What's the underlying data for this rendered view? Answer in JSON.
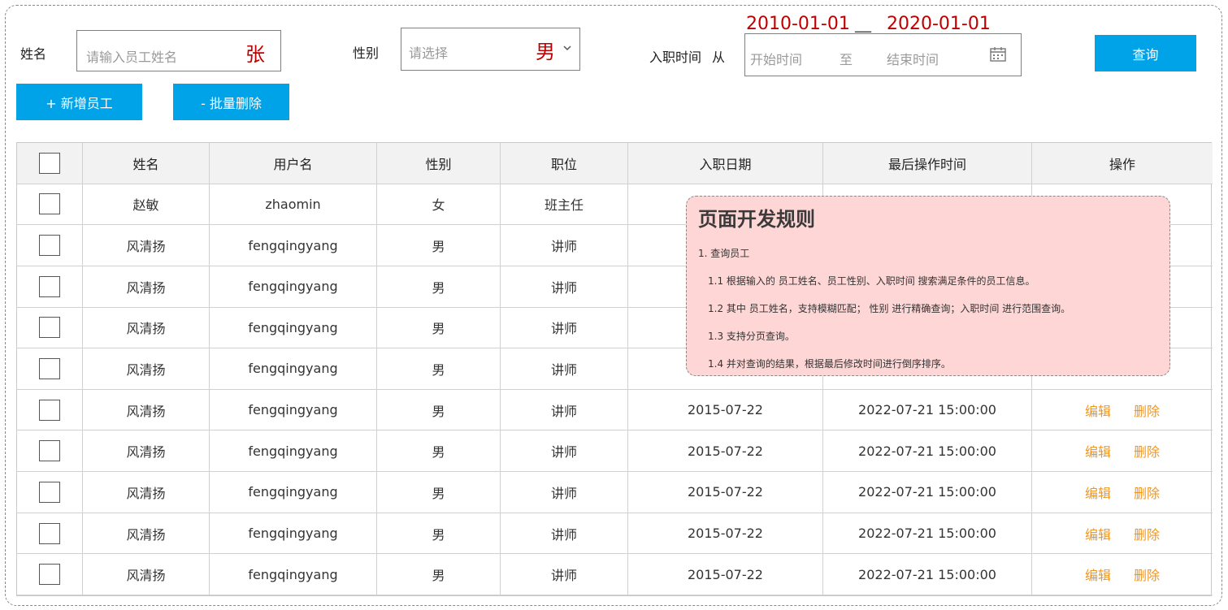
{
  "search": {
    "name_label": "姓名",
    "name_placeholder": "请输入员工姓名",
    "name_annotation": "张",
    "gender_label": "性别",
    "gender_placeholder": "请选择",
    "gender_annotation": "男",
    "date_label": "入职时间",
    "date_from": "从",
    "start_placeholder": "开始时间",
    "to_text": "至",
    "end_placeholder": "结束时间",
    "start_annotation": "2010-01-01",
    "end_annotation": "2020-01-01",
    "annotation_separator": "__",
    "query_button": "查询"
  },
  "toolbar": {
    "add_button": "+ 新增员工",
    "batch_delete_button": "- 批量删除"
  },
  "table": {
    "headers": [
      "姓名",
      "用户名",
      "性别",
      "职位",
      "入职日期",
      "最后操作时间",
      "操作"
    ],
    "rows": [
      {
        "name": "赵敏",
        "username": "zhaomin",
        "gender": "女",
        "position": "班主任",
        "entry": "",
        "updated": "",
        "edit": "",
        "delete": ""
      },
      {
        "name": "风清扬",
        "username": "fengqingyang",
        "gender": "男",
        "position": "讲师",
        "entry": "",
        "updated": "",
        "edit": "",
        "delete": ""
      },
      {
        "name": "风清扬",
        "username": "fengqingyang",
        "gender": "男",
        "position": "讲师",
        "entry": "",
        "updated": "",
        "edit": "",
        "delete": ""
      },
      {
        "name": "风清扬",
        "username": "fengqingyang",
        "gender": "男",
        "position": "讲师",
        "entry": "",
        "updated": "",
        "edit": "",
        "delete": ""
      },
      {
        "name": "风清扬",
        "username": "fengqingyang",
        "gender": "男",
        "position": "讲师",
        "entry": "",
        "updated": "",
        "edit": "",
        "delete": ""
      },
      {
        "name": "风清扬",
        "username": "fengqingyang",
        "gender": "男",
        "position": "讲师",
        "entry": "2015-07-22",
        "updated": "2022-07-21 15:00:00",
        "edit": "编辑",
        "delete": "删除"
      },
      {
        "name": "风清扬",
        "username": "fengqingyang",
        "gender": "男",
        "position": "讲师",
        "entry": "2015-07-22",
        "updated": "2022-07-21 15:00:00",
        "edit": "编辑",
        "delete": "删除"
      },
      {
        "name": "风清扬",
        "username": "fengqingyang",
        "gender": "男",
        "position": "讲师",
        "entry": "2015-07-22",
        "updated": "2022-07-21 15:00:00",
        "edit": "编辑",
        "delete": "删除"
      },
      {
        "name": "风清扬",
        "username": "fengqingyang",
        "gender": "男",
        "position": "讲师",
        "entry": "2015-07-22",
        "updated": "2022-07-21 15:00:00",
        "edit": "编辑",
        "delete": "删除"
      },
      {
        "name": "风清扬",
        "username": "fengqingyang",
        "gender": "男",
        "position": "讲师",
        "entry": "2015-07-22",
        "updated": "2022-07-21 15:00:00",
        "edit": "编辑",
        "delete": "删除"
      }
    ]
  },
  "note": {
    "title": "页面开发规则",
    "lines": [
      "1. 查询员工",
      "1.1 根据输入的 员工姓名、员工性别、入职时间 搜索满足条件的员工信息。",
      "1.2 其中 员工姓名，支持模糊匹配； 性别 进行精确查询；入职时间 进行范围查询。",
      "1.3 支持分页查询。",
      "1.4 并对查询的结果，根据最后修改时间进行倒序排序。"
    ]
  },
  "icons": {
    "select": "chevron-down-icon",
    "date": "calendar-icon",
    "checkbox": "checkbox-icon"
  },
  "colors": {
    "primary": "#00a2e8",
    "annotation": "#c00000",
    "action": "#f0961e",
    "note_bg": "#ffd6d6"
  }
}
